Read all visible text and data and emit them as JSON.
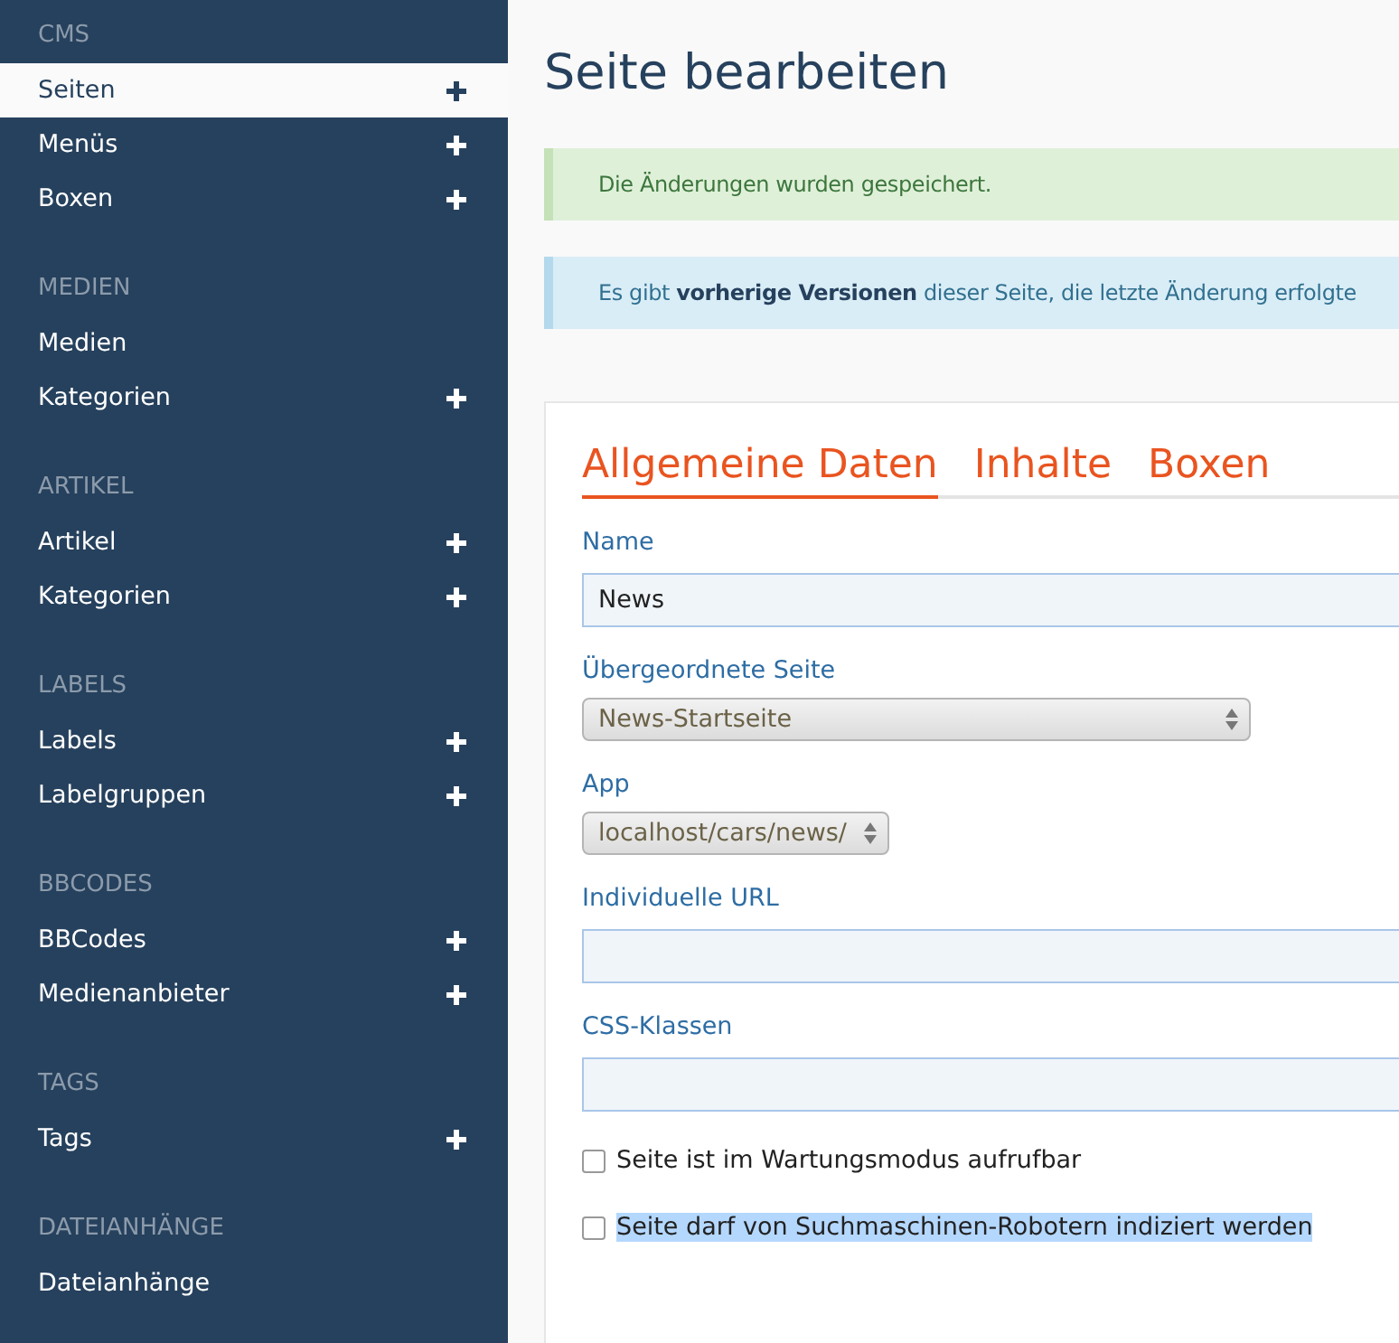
{
  "sidebar": {
    "sections": [
      {
        "title": "CMS",
        "items": [
          {
            "label": "Seiten",
            "add": true,
            "selected": true
          },
          {
            "label": "Menüs",
            "add": true,
            "selected": false
          },
          {
            "label": "Boxen",
            "add": true,
            "selected": false
          }
        ]
      },
      {
        "title": "MEDIEN",
        "items": [
          {
            "label": "Medien",
            "add": false,
            "selected": false
          },
          {
            "label": "Kategorien",
            "add": true,
            "selected": false
          }
        ]
      },
      {
        "title": "ARTIKEL",
        "items": [
          {
            "label": "Artikel",
            "add": true,
            "selected": false
          },
          {
            "label": "Kategorien",
            "add": true,
            "selected": false
          }
        ]
      },
      {
        "title": "LABELS",
        "items": [
          {
            "label": "Labels",
            "add": true,
            "selected": false
          },
          {
            "label": "Labelgruppen",
            "add": true,
            "selected": false
          }
        ]
      },
      {
        "title": "BBCODES",
        "items": [
          {
            "label": "BBCodes",
            "add": true,
            "selected": false
          },
          {
            "label": "Medienanbieter",
            "add": true,
            "selected": false
          }
        ]
      },
      {
        "title": "TAGS",
        "items": [
          {
            "label": "Tags",
            "add": true,
            "selected": false
          }
        ]
      },
      {
        "title": "DATEIANHÄNGE",
        "items": [
          {
            "label": "Dateianhänge",
            "add": false,
            "selected": false
          }
        ]
      }
    ]
  },
  "page_title": "Seite bearbeiten",
  "alerts": [
    {
      "kind": "success",
      "text": "Die Änderungen wurden gespeichert."
    },
    {
      "kind": "info",
      "text": "Es gibt **vorherige Versionen** dieser Seite, die letzte Änderung erfolgte"
    }
  ],
  "tabs": [
    {
      "label": "Allgemeine Daten",
      "selected": true
    },
    {
      "label": "Inhalte",
      "selected": false
    },
    {
      "label": "Boxen",
      "selected": false
    }
  ],
  "fields": [
    {
      "kind": "text",
      "label": "Name",
      "value": "News"
    },
    {
      "kind": "select",
      "label": "Übergeordnete Seite",
      "value": "News-Startseite"
    },
    {
      "kind": "select",
      "label": "App",
      "value": "localhost/cars/news/"
    },
    {
      "kind": "text",
      "label": "Individuelle URL"
    },
    {
      "kind": "text",
      "label": "CSS-Klassen"
    },
    {
      "kind": "checkbox",
      "label": "Seite ist im Wartungsmodus aufrufbar",
      "checked": false,
      "highlighted": false
    },
    {
      "kind": "checkbox",
      "label": "Seite darf von Suchmaschinen-Robotern indiziert werden",
      "checked": false,
      "highlighted": true
    }
  ]
}
